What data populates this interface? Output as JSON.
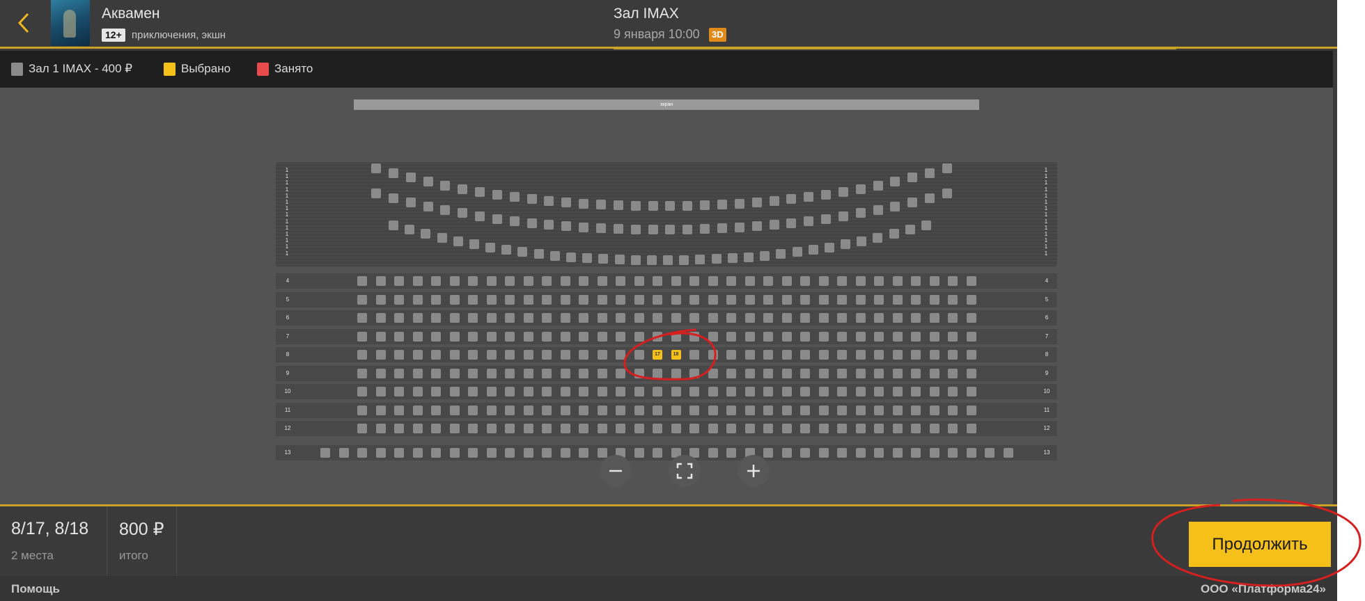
{
  "header": {
    "movie_title": "Аквамен",
    "age_rating": "12+",
    "genre": "приключения, экшн",
    "hall_title": "Зал IMAX",
    "show_time": "9 января 10:00",
    "format": "3D"
  },
  "legend": {
    "items": [
      {
        "label": "Зал 1 IMAX - 400 ₽",
        "color": "#8a8a8a"
      },
      {
        "label": "Выбрано",
        "color": "#f5c01a"
      },
      {
        "label": "Занято",
        "color": "#e84b4b"
      }
    ]
  },
  "seat_map": {
    "screen_label": "экран",
    "lower_rows": [
      "4",
      "5",
      "6",
      "7",
      "8",
      "9",
      "10",
      "11",
      "12"
    ],
    "last_row": "13",
    "selected_seats": [
      {
        "row": "8",
        "seat": "17"
      },
      {
        "row": "8",
        "seat": "18"
      }
    ]
  },
  "summary": {
    "seats": "8/17, 8/18",
    "seats_caption": "2 места",
    "total": "800 ₽",
    "total_caption": "итого"
  },
  "actions": {
    "continue_label": "Продолжить"
  },
  "footer": {
    "help": "Помощь",
    "company": "ООО «Платформа24»"
  }
}
